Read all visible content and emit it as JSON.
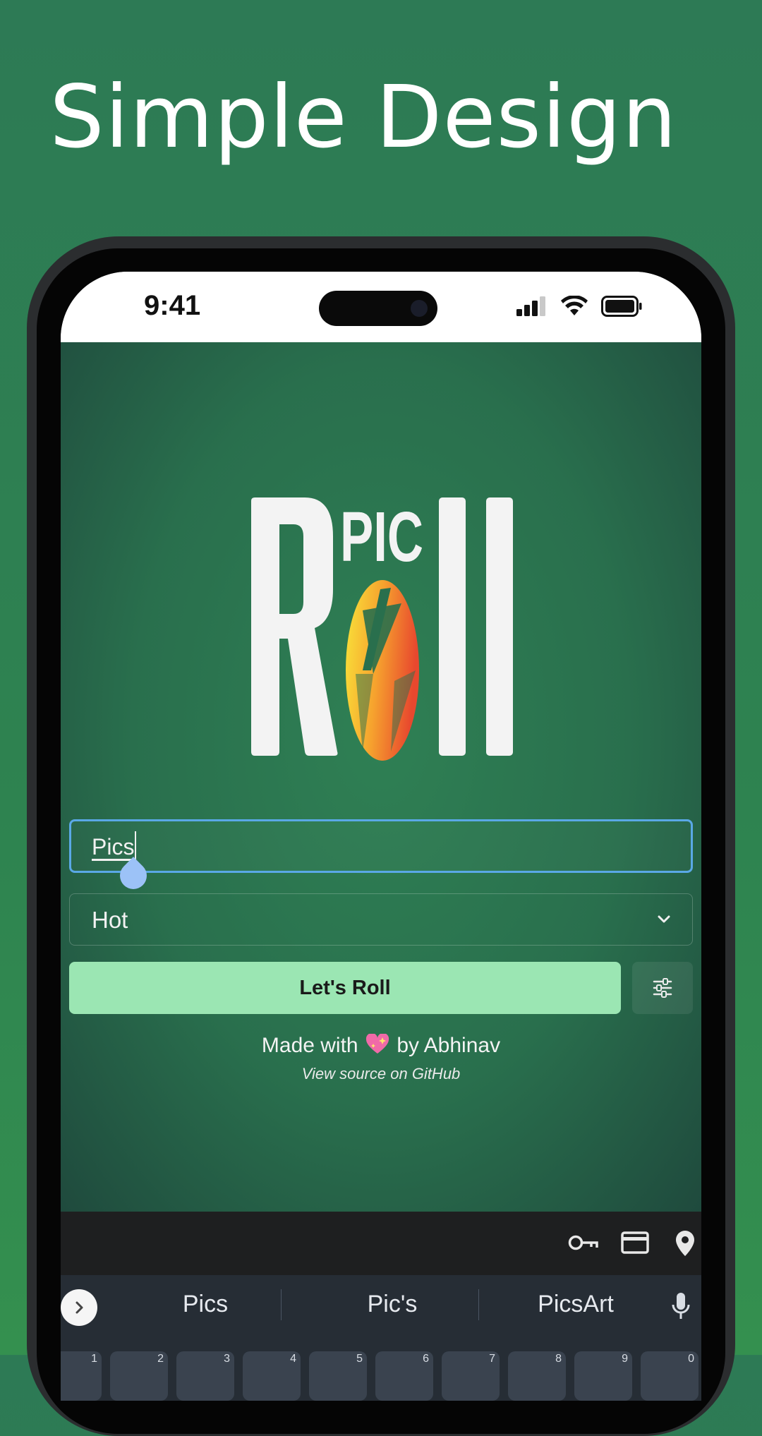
{
  "headline": "Simple Design",
  "status_bar": {
    "time": "9:41"
  },
  "logo": {
    "top_text": "PIC",
    "alt": "Pic Roll"
  },
  "search_field": {
    "value": "Pics"
  },
  "sort_select": {
    "selected": "Hot"
  },
  "roll_button": {
    "label": "Let's Roll"
  },
  "footer": {
    "made_with_prefix": "Made with",
    "made_with_suffix": "by Abhinav",
    "source_link": "View source on GitHub"
  },
  "keyboard": {
    "suggestions": [
      "Pics",
      "Pic's",
      "PicsArt"
    ],
    "number_keys": [
      "1",
      "2",
      "3",
      "4",
      "5",
      "6",
      "7",
      "8",
      "9",
      "0"
    ]
  },
  "colors": {
    "background": "#2e8350",
    "accent_button": "#9be6b3",
    "focus_border": "#5aa8e6"
  }
}
